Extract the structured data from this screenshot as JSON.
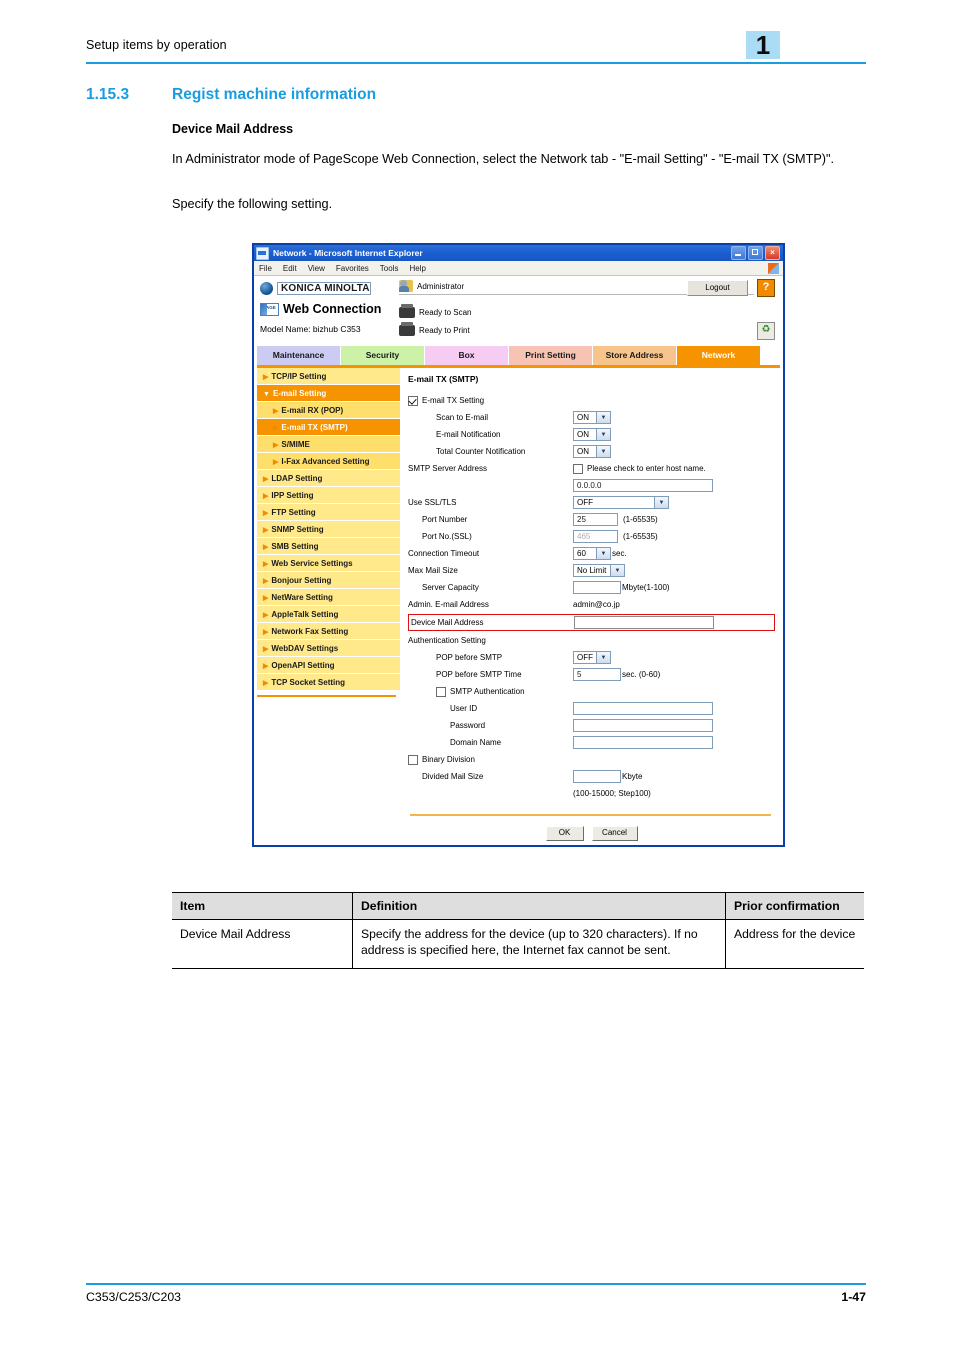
{
  "page": {
    "running_head": "Setup items by operation",
    "chapter_badge": "1",
    "footer_left": "C353/C253/C203",
    "footer_right": "1-47"
  },
  "section": {
    "number": "1.15.3",
    "title": "Regist machine information",
    "sub_heading": "Device Mail Address",
    "para1": "In Administrator mode of PageScope Web Connection, select the Network tab - \"E-mail Setting\" - \"E-mail TX (SMTP)\".",
    "para2": "Specify the following setting."
  },
  "browser": {
    "title": "Network - Microsoft Internet Explorer",
    "menu": [
      "File",
      "Edit",
      "View",
      "Favorites",
      "Tools",
      "Help"
    ],
    "window_buttons": [
      "minimize-button",
      "maximize-button",
      "close-button"
    ]
  },
  "app": {
    "brand": "KONICA MINOLTA",
    "product": "Web Connection",
    "product_mark_line1": "PAGE",
    "product_mark_line2": "SCOPE",
    "model_name": "Model Name: bizhub C353",
    "user_label": "Administrator",
    "status_scan": "Ready to Scan",
    "status_print": "Ready to Print",
    "logout_label": "Logout",
    "help_label": "?",
    "refresh_label": "♻"
  },
  "tabs": [
    {
      "label": "Maintenance",
      "color": "#ccccf2",
      "active": false
    },
    {
      "label": "Security",
      "color": "#ccf2a8",
      "active": false
    },
    {
      "label": "Box",
      "color": "#f7ccf2",
      "active": false
    },
    {
      "label": "Print Setting",
      "color": "#f7c4b4",
      "active": false
    },
    {
      "label": "Store Address",
      "color": "#f7c48c",
      "active": false
    },
    {
      "label": "Network",
      "color": "#f59300",
      "active": true
    }
  ],
  "sidebar": [
    {
      "label": "TCP/IP Setting",
      "level": 0,
      "active": false
    },
    {
      "label": "E-mail Setting",
      "level": 0,
      "active": true,
      "expanded": true
    },
    {
      "label": "E-mail RX (POP)",
      "level": 1,
      "active": false
    },
    {
      "label": "E-mail TX (SMTP)",
      "level": 1,
      "active": true
    },
    {
      "label": "S/MIME",
      "level": 1,
      "active": false
    },
    {
      "label": "I-Fax Advanced Setting",
      "level": 1,
      "active": false
    },
    {
      "label": "LDAP Setting",
      "level": 0,
      "active": false
    },
    {
      "label": "IPP Setting",
      "level": 0,
      "active": false
    },
    {
      "label": "FTP Setting",
      "level": 0,
      "active": false
    },
    {
      "label": "SNMP Setting",
      "level": 0,
      "active": false
    },
    {
      "label": "SMB Setting",
      "level": 0,
      "active": false
    },
    {
      "label": "Web Service Settings",
      "level": 0,
      "active": false
    },
    {
      "label": "Bonjour Setting",
      "level": 0,
      "active": false
    },
    {
      "label": "NetWare Setting",
      "level": 0,
      "active": false
    },
    {
      "label": "AppleTalk Setting",
      "level": 0,
      "active": false
    },
    {
      "label": "Network Fax Setting",
      "level": 0,
      "active": false
    },
    {
      "label": "WebDAV Settings",
      "level": 0,
      "active": false
    },
    {
      "label": "OpenAPI Setting",
      "level": 0,
      "active": false
    },
    {
      "label": "TCP Socket Setting",
      "level": 0,
      "active": false
    }
  ],
  "form": {
    "panel_title": "E-mail TX (SMTP)",
    "email_tx_setting_label": "E-mail TX Setting",
    "scan_to_email_label": "Scan to E-mail",
    "scan_to_email_value": "ON",
    "email_notification_label": "E-mail Notification",
    "email_notification_value": "ON",
    "total_counter_label": "Total Counter Notification",
    "total_counter_value": "ON",
    "smtp_server_label": "SMTP Server Address",
    "host_name_checkbox_label": "Please check to enter host name.",
    "smtp_server_value": "0.0.0.0",
    "use_ssl_label": "Use SSL/TLS",
    "use_ssl_value": "OFF",
    "port_number_label": "Port Number",
    "port_number_value": "25",
    "port_number_range": "(1-65535)",
    "port_ssl_label": "Port No.(SSL)",
    "port_ssl_value": "465",
    "port_ssl_range": "(1-65535)",
    "connection_timeout_label": "Connection Timeout",
    "connection_timeout_value": "60",
    "connection_timeout_unit": "sec.",
    "max_mail_size_label": "Max Mail Size",
    "max_mail_size_value": "No Limit",
    "server_capacity_label": "Server Capacity",
    "server_capacity_value": "",
    "server_capacity_unit": "Mbyte(1-100)",
    "admin_email_label": "Admin. E-mail Address",
    "admin_email_value": "admin@co.jp",
    "device_mail_label": "Device Mail Address",
    "device_mail_value": "",
    "auth_setting_label": "Authentication Setting",
    "pop_before_smtp_label": "POP before SMTP",
    "pop_before_smtp_value": "OFF",
    "pop_before_smtp_time_label": "POP before SMTP Time",
    "pop_before_smtp_time_value": "5",
    "pop_before_smtp_time_unit": "sec. (0-60)",
    "smtp_auth_label": "SMTP Authentication",
    "user_id_label": "User ID",
    "user_id_value": "",
    "password_label": "Password",
    "password_value": "",
    "domain_name_label": "Domain Name",
    "domain_name_value": "",
    "binary_division_label": "Binary Division",
    "divided_mail_size_label": "Divided Mail Size",
    "divided_mail_size_value": "",
    "divided_mail_size_unit": "Kbyte",
    "divided_mail_size_range": "(100-15000; Step100)",
    "ok_label": "OK",
    "cancel_label": "Cancel"
  },
  "table": {
    "headers": [
      "Item",
      "Definition",
      "Prior confirmation"
    ],
    "rows": [
      {
        "item": "Device Mail Address",
        "definition": "Specify the address for the device (up to 320 characters). If no address is specified here, the Internet fax cannot be sent.",
        "prior": "Address for the device"
      }
    ]
  },
  "colors": {
    "accent_blue": "#1a9de0",
    "tab_active": "#f59300",
    "highlight_red": "#e01010"
  }
}
